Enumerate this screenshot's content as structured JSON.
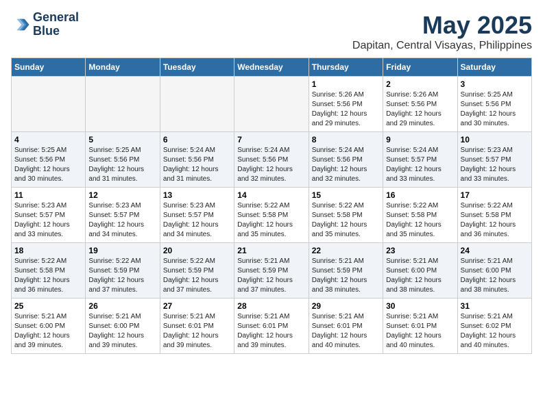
{
  "logo": {
    "line1": "General",
    "line2": "Blue"
  },
  "title": "May 2025",
  "location": "Dapitan, Central Visayas, Philippines",
  "days_of_week": [
    "Sunday",
    "Monday",
    "Tuesday",
    "Wednesday",
    "Thursday",
    "Friday",
    "Saturday"
  ],
  "weeks": [
    [
      {
        "day": "",
        "info": ""
      },
      {
        "day": "",
        "info": ""
      },
      {
        "day": "",
        "info": ""
      },
      {
        "day": "",
        "info": ""
      },
      {
        "day": "1",
        "info": "Sunrise: 5:26 AM\nSunset: 5:56 PM\nDaylight: 12 hours\nand 29 minutes."
      },
      {
        "day": "2",
        "info": "Sunrise: 5:26 AM\nSunset: 5:56 PM\nDaylight: 12 hours\nand 29 minutes."
      },
      {
        "day": "3",
        "info": "Sunrise: 5:25 AM\nSunset: 5:56 PM\nDaylight: 12 hours\nand 30 minutes."
      }
    ],
    [
      {
        "day": "4",
        "info": "Sunrise: 5:25 AM\nSunset: 5:56 PM\nDaylight: 12 hours\nand 30 minutes."
      },
      {
        "day": "5",
        "info": "Sunrise: 5:25 AM\nSunset: 5:56 PM\nDaylight: 12 hours\nand 31 minutes."
      },
      {
        "day": "6",
        "info": "Sunrise: 5:24 AM\nSunset: 5:56 PM\nDaylight: 12 hours\nand 31 minutes."
      },
      {
        "day": "7",
        "info": "Sunrise: 5:24 AM\nSunset: 5:56 PM\nDaylight: 12 hours\nand 32 minutes."
      },
      {
        "day": "8",
        "info": "Sunrise: 5:24 AM\nSunset: 5:56 PM\nDaylight: 12 hours\nand 32 minutes."
      },
      {
        "day": "9",
        "info": "Sunrise: 5:24 AM\nSunset: 5:57 PM\nDaylight: 12 hours\nand 33 minutes."
      },
      {
        "day": "10",
        "info": "Sunrise: 5:23 AM\nSunset: 5:57 PM\nDaylight: 12 hours\nand 33 minutes."
      }
    ],
    [
      {
        "day": "11",
        "info": "Sunrise: 5:23 AM\nSunset: 5:57 PM\nDaylight: 12 hours\nand 33 minutes."
      },
      {
        "day": "12",
        "info": "Sunrise: 5:23 AM\nSunset: 5:57 PM\nDaylight: 12 hours\nand 34 minutes."
      },
      {
        "day": "13",
        "info": "Sunrise: 5:23 AM\nSunset: 5:57 PM\nDaylight: 12 hours\nand 34 minutes."
      },
      {
        "day": "14",
        "info": "Sunrise: 5:22 AM\nSunset: 5:58 PM\nDaylight: 12 hours\nand 35 minutes."
      },
      {
        "day": "15",
        "info": "Sunrise: 5:22 AM\nSunset: 5:58 PM\nDaylight: 12 hours\nand 35 minutes."
      },
      {
        "day": "16",
        "info": "Sunrise: 5:22 AM\nSunset: 5:58 PM\nDaylight: 12 hours\nand 35 minutes."
      },
      {
        "day": "17",
        "info": "Sunrise: 5:22 AM\nSunset: 5:58 PM\nDaylight: 12 hours\nand 36 minutes."
      }
    ],
    [
      {
        "day": "18",
        "info": "Sunrise: 5:22 AM\nSunset: 5:58 PM\nDaylight: 12 hours\nand 36 minutes."
      },
      {
        "day": "19",
        "info": "Sunrise: 5:22 AM\nSunset: 5:59 PM\nDaylight: 12 hours\nand 37 minutes."
      },
      {
        "day": "20",
        "info": "Sunrise: 5:22 AM\nSunset: 5:59 PM\nDaylight: 12 hours\nand 37 minutes."
      },
      {
        "day": "21",
        "info": "Sunrise: 5:21 AM\nSunset: 5:59 PM\nDaylight: 12 hours\nand 37 minutes."
      },
      {
        "day": "22",
        "info": "Sunrise: 5:21 AM\nSunset: 5:59 PM\nDaylight: 12 hours\nand 38 minutes."
      },
      {
        "day": "23",
        "info": "Sunrise: 5:21 AM\nSunset: 6:00 PM\nDaylight: 12 hours\nand 38 minutes."
      },
      {
        "day": "24",
        "info": "Sunrise: 5:21 AM\nSunset: 6:00 PM\nDaylight: 12 hours\nand 38 minutes."
      }
    ],
    [
      {
        "day": "25",
        "info": "Sunrise: 5:21 AM\nSunset: 6:00 PM\nDaylight: 12 hours\nand 39 minutes."
      },
      {
        "day": "26",
        "info": "Sunrise: 5:21 AM\nSunset: 6:00 PM\nDaylight: 12 hours\nand 39 minutes."
      },
      {
        "day": "27",
        "info": "Sunrise: 5:21 AM\nSunset: 6:01 PM\nDaylight: 12 hours\nand 39 minutes."
      },
      {
        "day": "28",
        "info": "Sunrise: 5:21 AM\nSunset: 6:01 PM\nDaylight: 12 hours\nand 39 minutes."
      },
      {
        "day": "29",
        "info": "Sunrise: 5:21 AM\nSunset: 6:01 PM\nDaylight: 12 hours\nand 40 minutes."
      },
      {
        "day": "30",
        "info": "Sunrise: 5:21 AM\nSunset: 6:01 PM\nDaylight: 12 hours\nand 40 minutes."
      },
      {
        "day": "31",
        "info": "Sunrise: 5:21 AM\nSunset: 6:02 PM\nDaylight: 12 hours\nand 40 minutes."
      }
    ]
  ]
}
